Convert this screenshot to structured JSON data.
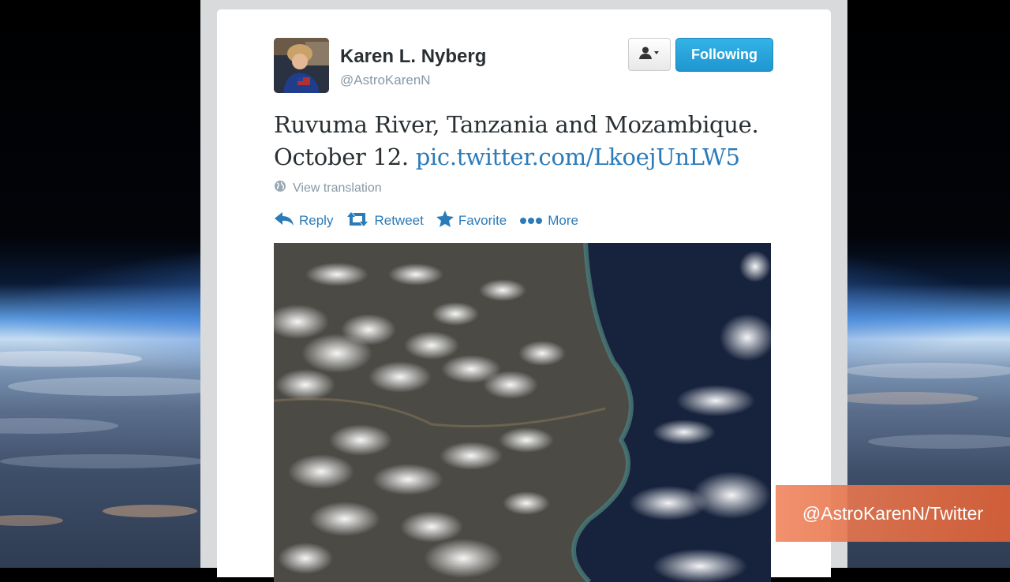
{
  "tweet": {
    "author_name": "Karen L. Nyberg",
    "author_handle": "@AstroKarenN",
    "follow_button_label": "Following",
    "text_line1": "Ruvuma River,  Tanzania and Mozambique.",
    "text_line2_prefix": "October 12. ",
    "text_link": "pic.twitter.com/LkoejUnLW5",
    "view_translation_label": "View translation",
    "actions": {
      "reply": "Reply",
      "retweet": "Retweet",
      "favorite": "Favorite",
      "more": "More"
    }
  },
  "overlay": {
    "watermark_text": "@AstroKarenN/Twitter"
  },
  "colors": {
    "link": "#2b7bb9",
    "follow_button": "#1f96d0",
    "watermark": "#e0744a"
  },
  "icons": [
    "user-dropdown-icon",
    "globe-icon",
    "reply-icon",
    "retweet-icon",
    "star-icon",
    "more-dots-icon"
  ]
}
